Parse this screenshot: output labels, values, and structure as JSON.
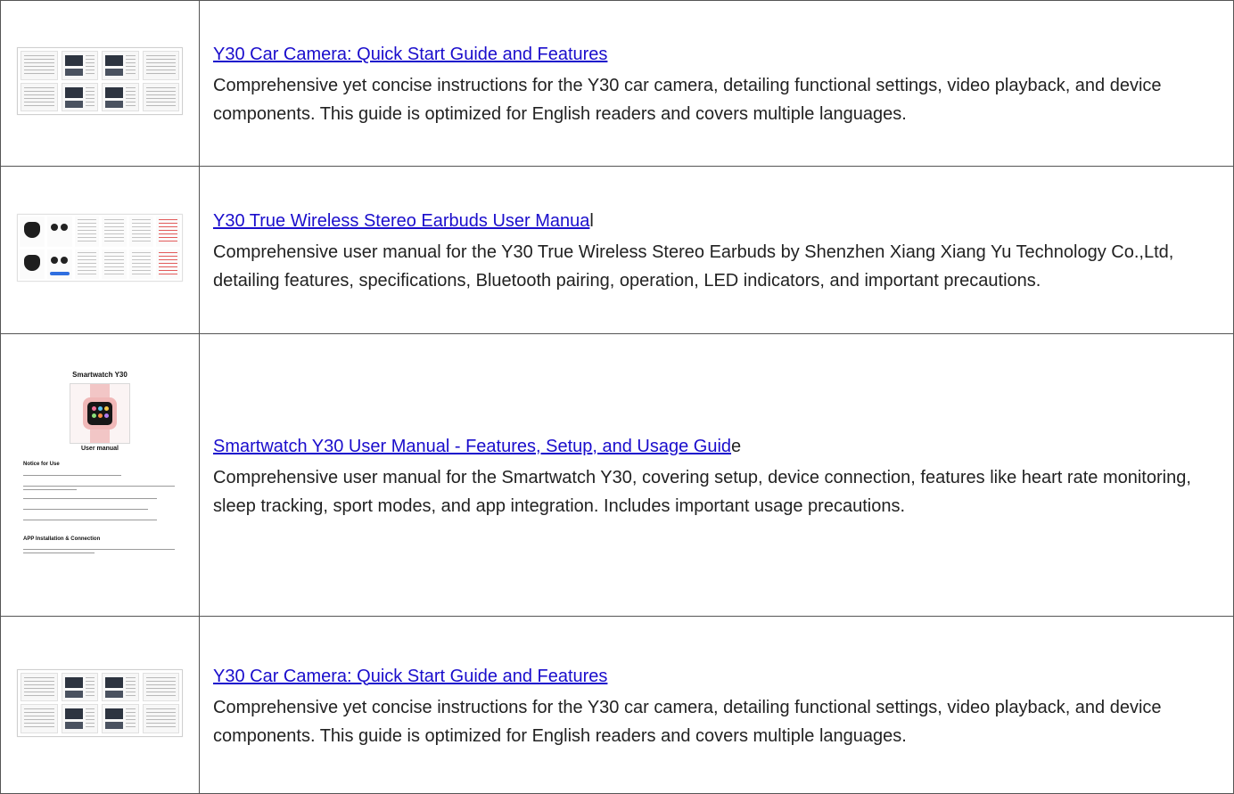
{
  "rows": [
    {
      "title": "Y30 Car Camera: Quick Start Guide and Features",
      "title_suffix": "",
      "description": "Comprehensive yet concise instructions for the Y30 car camera, detailing functional settings, video playback, and device components. This guide is optimized for English readers and covers multiple languages.",
      "thumbnail": "car-camera-manual-thumbnail"
    },
    {
      "title": "Y30 True Wireless Stereo Earbuds User Manua",
      "title_suffix": "l",
      "description": "Comprehensive user manual for the Y30 True Wireless Stereo Earbuds by Shenzhen Xiang Xiang Yu Technology Co.,Ltd, detailing features, specifications, Bluetooth pairing, operation, LED indicators, and important precautions.",
      "thumbnail": "earbuds-manual-thumbnail"
    },
    {
      "title": "Smartwatch Y30 User Manual - Features, Setup, and Usage Guid",
      "title_suffix": "e",
      "description": "Comprehensive user manual for the Smartwatch Y30, covering setup, device connection, features like heart rate monitoring, sleep tracking, sport modes, and app integration. Includes important usage precautions.",
      "thumbnail": "smartwatch-manual-thumbnail",
      "thumb_text": {
        "title": "Smartwatch Y30",
        "subtitle": "User manual",
        "notice_heading": "Notice for Use",
        "app_heading": "APP Installation & Connection"
      }
    },
    {
      "title": "Y30 Car Camera: Quick Start Guide and Features",
      "title_suffix": "",
      "description": "Comprehensive yet concise instructions for the Y30 car camera, detailing functional settings, video playback, and device components. This guide is optimized for English readers and covers multiple languages.",
      "thumbnail": "car-camera-manual-thumbnail"
    }
  ],
  "colors": {
    "link": "#1a0dcc",
    "text": "#222222",
    "border": "#555555"
  }
}
